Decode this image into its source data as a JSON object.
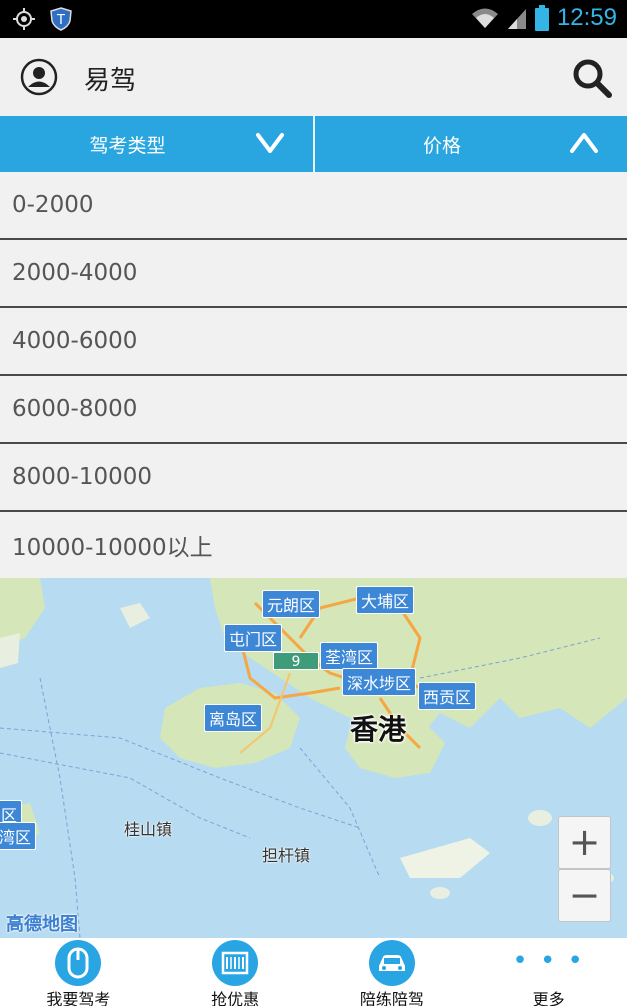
{
  "status_bar": {
    "time": "12:59",
    "icons": [
      "gps-icon",
      "shield-app-icon",
      "wifi-icon",
      "signal-icon",
      "battery-icon"
    ]
  },
  "app_bar": {
    "title": "易驾",
    "icons": [
      "user-avatar-icon",
      "search-icon"
    ]
  },
  "filters": [
    {
      "label": "驾考类型",
      "state": "collapsed"
    },
    {
      "label": "价格",
      "state": "expanded"
    }
  ],
  "price_ranges": [
    "0-2000",
    "2000-4000",
    "4000-6000",
    "6000-8000",
    "8000-10000",
    "10000-10000以上"
  ],
  "map": {
    "district_labels": [
      "元朗区",
      "大埔区",
      "屯门区",
      "荃湾区",
      "深水埗区",
      "西贡区",
      "离岛区",
      "区",
      "湾区"
    ],
    "route_badge": "9",
    "town_labels": [
      "桂山镇",
      "担杆镇"
    ],
    "city_label": "香港",
    "logo": "高德地图",
    "zoom_in": "+",
    "zoom_out": "−"
  },
  "bottom_nav": [
    {
      "label": "我要驾考",
      "icon": "mouse-icon"
    },
    {
      "label": "抢优惠",
      "icon": "coupon-icon"
    },
    {
      "label": "陪练陪驾",
      "icon": "car-icon"
    },
    {
      "label": "更多",
      "icon": "more-dots-icon"
    }
  ],
  "colors": {
    "accent": "#29a6e0",
    "map_water": "#b7dbf0",
    "map_land": "#d5e6b8",
    "status_icon": "#33b5e5"
  }
}
